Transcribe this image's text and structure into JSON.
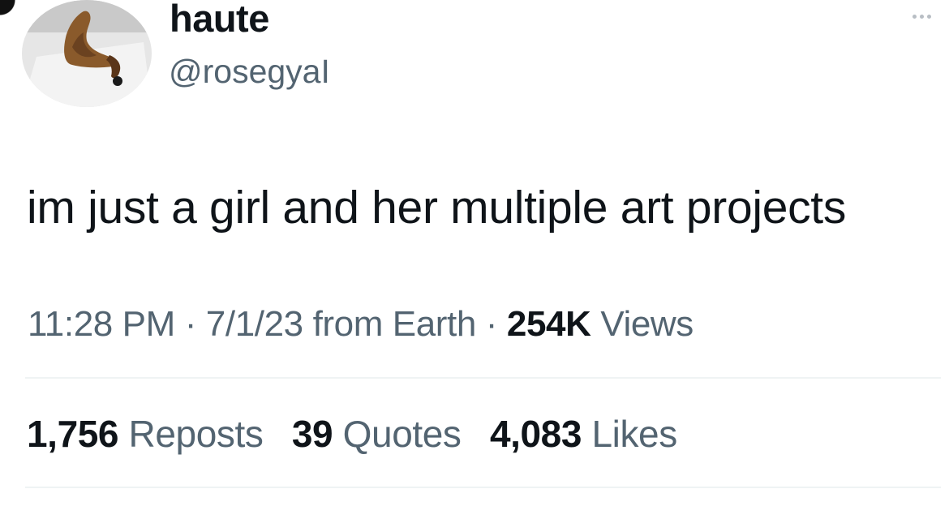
{
  "author": {
    "display_name": "haute",
    "handle": "@rosegyaI",
    "avatar": "sculpture-photo"
  },
  "tweet": {
    "text": "im just a girl and her multiple art projects"
  },
  "meta": {
    "time": "11:28 PM",
    "separator": "·",
    "date": "7/1/23",
    "source": "from Earth",
    "views_count": "254K",
    "views_label": "Views"
  },
  "stats": {
    "reposts_count": "1,756",
    "reposts_label": "Reposts",
    "quotes_count": "39",
    "quotes_label": "Quotes",
    "likes_count": "4,083",
    "likes_label": "Likes"
  },
  "icons": {
    "more": "more-icon"
  }
}
